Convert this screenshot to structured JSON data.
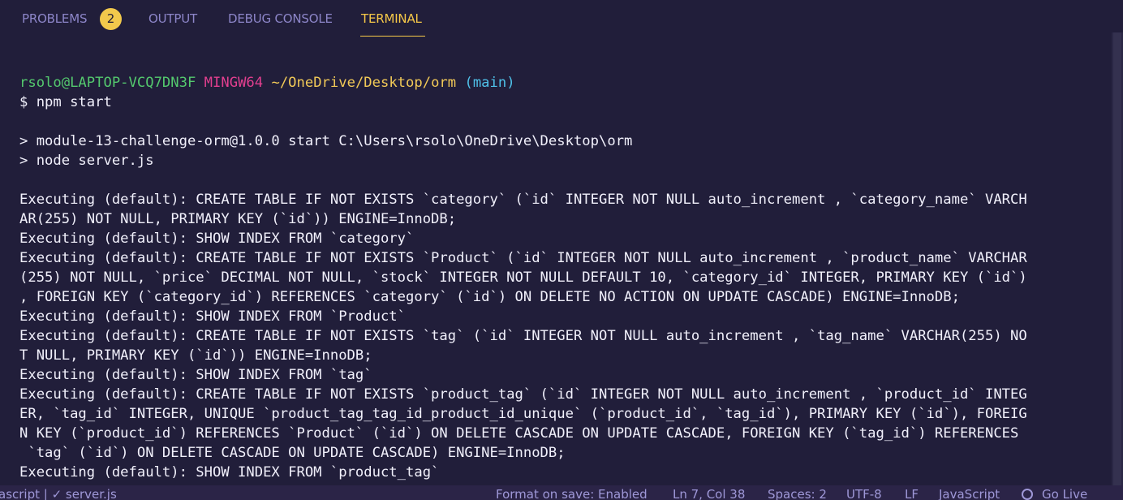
{
  "panel": {
    "tabs": [
      {
        "label": "PROBLEMS",
        "badge": "2"
      },
      {
        "label": "OUTPUT"
      },
      {
        "label": "DEBUG CONSOLE"
      },
      {
        "label": "TERMINAL",
        "active": true
      }
    ],
    "accent_color": "#f7c948"
  },
  "terminal": {
    "prompt": {
      "user_host": "rsolo@LAPTOP-VCQ7DN3F",
      "system": "MINGW64",
      "path": "~/OneDrive/Desktop/orm",
      "branch": "(main)"
    },
    "command": "$ npm start",
    "script_lines": [
      "> module-13-challenge-orm@1.0.0 start C:\\Users\\rsolo\\OneDrive\\Desktop\\orm",
      "> node server.js"
    ],
    "output_lines": [
      "Executing (default): CREATE TABLE IF NOT EXISTS `category` (`id` INTEGER NOT NULL auto_increment , `category_name` VARCH",
      "AR(255) NOT NULL, PRIMARY KEY (`id`)) ENGINE=InnoDB;",
      "Executing (default): SHOW INDEX FROM `category`",
      "Executing (default): CREATE TABLE IF NOT EXISTS `Product` (`id` INTEGER NOT NULL auto_increment , `product_name` VARCHAR",
      "(255) NOT NULL, `price` DECIMAL NOT NULL, `stock` INTEGER NOT NULL DEFAULT 10, `category_id` INTEGER, PRIMARY KEY (`id`)",
      ", FOREIGN KEY (`category_id`) REFERENCES `category` (`id`) ON DELETE NO ACTION ON UPDATE CASCADE) ENGINE=InnoDB;",
      "Executing (default): SHOW INDEX FROM `Product`",
      "Executing (default): CREATE TABLE IF NOT EXISTS `tag` (`id` INTEGER NOT NULL auto_increment , `tag_name` VARCHAR(255) NO",
      "T NULL, PRIMARY KEY (`id`)) ENGINE=InnoDB;",
      "Executing (default): SHOW INDEX FROM `tag`",
      "Executing (default): CREATE TABLE IF NOT EXISTS `product_tag` (`id` INTEGER NOT NULL auto_increment , `product_id` INTEG",
      "ER, `tag_id` INTEGER, UNIQUE `product_tag_tag_id_product_id_unique` (`product_id`, `tag_id`), PRIMARY KEY (`id`), FOREIG",
      "N KEY (`product_id`) REFERENCES `Product` (`id`) ON DELETE CASCADE ON UPDATE CASCADE, FOREIGN KEY (`tag_id`) REFERENCES",
      " `tag` (`id`) ON DELETE CASCADE ON UPDATE CASCADE) ENGINE=InnoDB;",
      "Executing (default): SHOW INDEX FROM `product_tag`"
    ],
    "colors": {
      "background": "#211e3a",
      "prompt_user": "#54c96e",
      "prompt_system": "#e23f8f",
      "prompt_path": "#f1c957",
      "prompt_branch": "#4fc1e9"
    }
  },
  "statusbar": {
    "left_text": "ascript | ✓ server.js",
    "format_on_save": "Format on save: Enabled",
    "cursor": "Ln 7, Col 38",
    "spaces": "Spaces: 2",
    "encoding": "UTF-8",
    "eol": "LF",
    "language": "JavaScript",
    "go_live": "Go Live",
    "go_live_icon": "broadcast-icon"
  }
}
